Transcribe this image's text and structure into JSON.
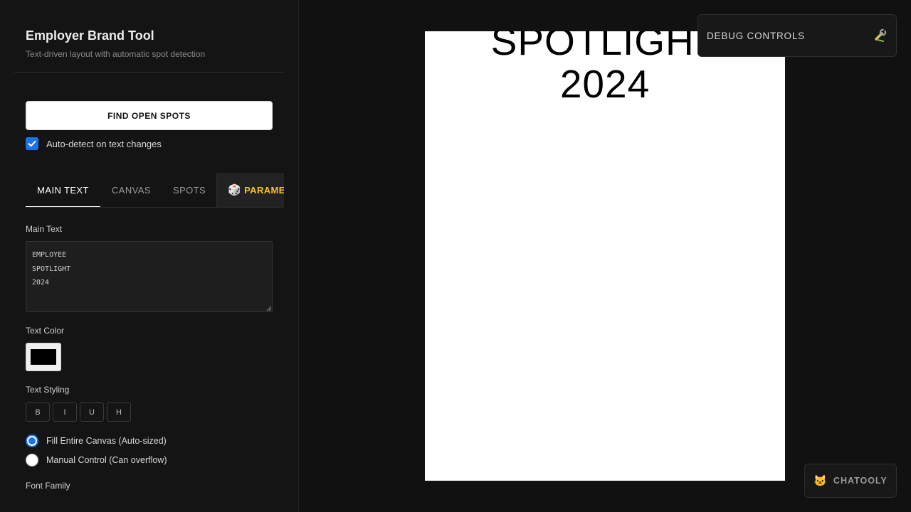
{
  "sidebar": {
    "title": "Employer Brand Tool",
    "subtitle": "Text-driven layout with automatic spot detection",
    "find_button": "FIND OPEN SPOTS",
    "auto_detect_label": "Auto-detect on text changes",
    "auto_detect_checked": true,
    "tabs": [
      {
        "label": "MAIN TEXT",
        "active": true
      },
      {
        "label": "CANVAS",
        "active": false
      },
      {
        "label": "SPOTS",
        "active": false
      },
      {
        "label": "PARAMETERS",
        "icon": "dice-icon",
        "active": false
      }
    ],
    "main_text_label": "Main Text",
    "main_text_value": "EMPLOYEE\nSPOTLIGHT\n2024",
    "text_color_label": "Text Color",
    "text_color_value": "#000000",
    "text_styling_label": "Text Styling",
    "style_buttons": [
      "B",
      "I",
      "U",
      "H"
    ],
    "sizing_options": [
      {
        "label": "Fill Entire Canvas (Auto-sized)",
        "checked": true
      },
      {
        "label": "Manual Control (Can overflow)",
        "checked": false
      }
    ],
    "font_family_label": "Font Family"
  },
  "canvas": {
    "lines": [
      "SPOTLIGHT",
      "2024"
    ],
    "background": "#ffffff",
    "text_color": "#000000"
  },
  "debug": {
    "title": "DEBUG CONTROLS",
    "icon": "wrench-icon"
  },
  "chatooly": {
    "label": "CHATOOLY",
    "icon": "cat-icon"
  },
  "colors": {
    "accent": "#1a73e8",
    "params_tab": "#f5c518",
    "background": "#111111"
  }
}
